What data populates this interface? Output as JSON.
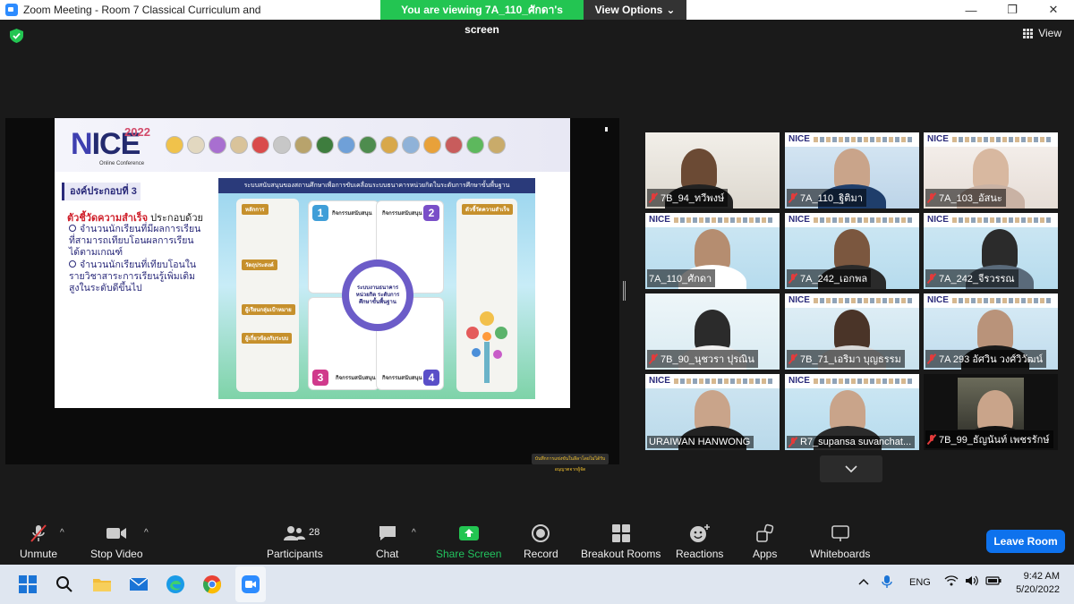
{
  "window": {
    "title": "Zoom Meeting - Room 7 Classical Curriculum and",
    "viewing_banner": "You are viewing 7A_110_ศักดา's screen",
    "view_options": "View Options",
    "view_button": "View"
  },
  "slide": {
    "logo_year": "2022",
    "logo_main_n": "N",
    "logo_main_ice": "ICE",
    "logo_sub": "Online Conference",
    "component_title": "องค์ประกอบที่ 3",
    "indicator_label": "ตัวชี้วัดความสำเร็จ",
    "indicator_rest": " ประกอบด้วย",
    "bullets": [
      "จำนวนนักเรียนที่มีผลการเรียนที่สามารถเทียบโอนผลการเรียนได้ตามเกณฑ์",
      "จำนวนนักเรียนที่เทียบโอนในรายวิชาสาระการเรียนรู้เพิ่มเติมสูงในระดับดีขึ้นไป"
    ],
    "diagram_title": "ระบบสนับสนุนของสถานศึกษาเพื่อการขับเคลื่อนระบบธนาคารหน่วยกิตในระดับการศึกษาขั้นพื้นฐาน",
    "left_col_head": "หลักการ",
    "left_col_items": [
      "วัตถุประสงค์",
      "ผู้เรียนกลุ่มเป้าหมาย",
      "ผู้เกี่ยวข้องกับระบบ"
    ],
    "quadrants": [
      {
        "num": "1",
        "label": "กิจกรรมสนับสนุน"
      },
      {
        "num": "2",
        "label": "กิจกรรมสนับสนุน"
      },
      {
        "num": "3",
        "label": "กิจกรรมสนับสนุน"
      },
      {
        "num": "4",
        "label": "กิจกรรมสนับสนุน"
      }
    ],
    "center_text": "ระบบงานธนาคารหน่วยกิต ระดับการศึกษาขั้นพื้นฐาน",
    "right_col_head": "ตัวชี้วัดความสำเร็จ",
    "warning": "บันทึกการแข่งขันในลีลาโดยไม่ได้รับอนุญาตจากผู้จัด"
  },
  "participants_tiles": [
    {
      "name": "7B_94_ทวีพงษ์",
      "muted": true
    },
    {
      "name": "7A_110_ฐิติมา",
      "muted": true
    },
    {
      "name": "7A_103_อัสนะ",
      "muted": true
    },
    {
      "name": "7A_110_ศักดา",
      "muted": false,
      "active": true
    },
    {
      "name": "7A_242_เอกพล",
      "muted": true
    },
    {
      "name": "7A_242_จีรวรรณ",
      "muted": true
    },
    {
      "name": "7B_90_นุชวรา ปุรณิน",
      "muted": true
    },
    {
      "name": "7B_71_เอริมา บุญธรรม",
      "muted": true
    },
    {
      "name": "7A 293 อัศวิน วงศ์วิวัฒน์",
      "muted": true
    },
    {
      "name": "URAIWAN HANWONG",
      "muted": false
    },
    {
      "name": "R7_supansa suvanchat...",
      "muted": true
    },
    {
      "name": "7B_99_ธัญนันท์ เพชรรักษ์",
      "muted": true
    }
  ],
  "toolbar": {
    "unmute": "Unmute",
    "stop_video": "Stop Video",
    "participants": "Participants",
    "participants_count": "28",
    "chat": "Chat",
    "share_screen": "Share Screen",
    "record": "Record",
    "breakout_rooms": "Breakout Rooms",
    "reactions": "Reactions",
    "apps": "Apps",
    "whiteboards": "Whiteboards",
    "leave_room": "Leave Room"
  },
  "taskbar": {
    "lang": "ENG",
    "time": "9:42 AM",
    "date": "5/20/2022"
  },
  "colors": {
    "zoom_blue": "#0e72ed",
    "share_green": "#23c552",
    "muted_red": "#e23b3b",
    "active_speaker": "#e7e338"
  }
}
